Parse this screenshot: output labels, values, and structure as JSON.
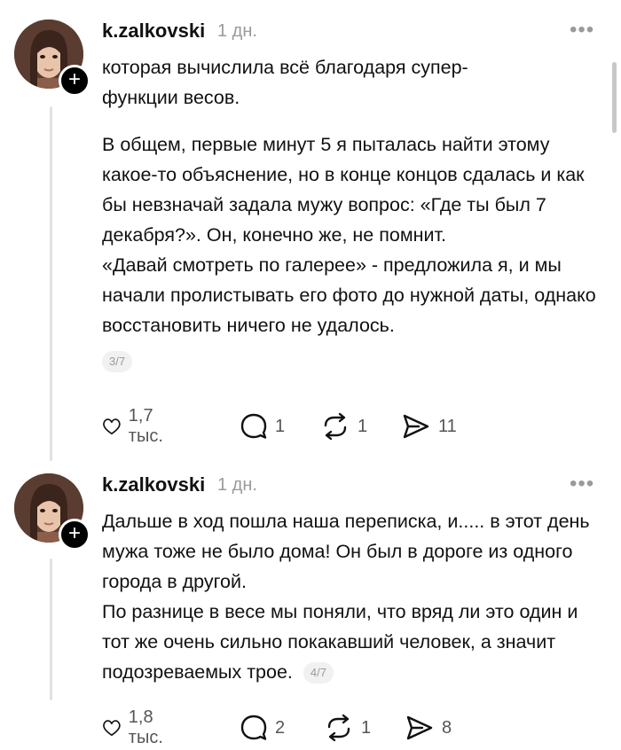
{
  "posts": [
    {
      "username": "k.zalkovski",
      "time": "1 дн.",
      "paragraphs": [
        "которая вычислила всё благодаря супер-функции весов.",
        "В общем, первые минут 5 я пыталась найти этому какое-то объяснение, но в конце концов сдалась и как бы невзначай задала мужу вопрос: «Где ты был 7 декабря?». Он, конечно же, не помнит.",
        "«Давай смотреть по галерее» - предложила я, и мы начали пролистывать его фото до нужной даты, однако восстановить ничего не удалось."
      ],
      "pager": "3/7",
      "likes": "1,7 тыс.",
      "comments": "1",
      "reposts": "1",
      "shares": "11"
    },
    {
      "username": "k.zalkovski",
      "time": "1 дн.",
      "paragraphs": [
        "Дальше в ход пошла наша переписка, и..... в этот день мужа тоже не было дома! Он был в дороге из одного города в другой.",
        "По разнице в весе мы поняли, что вряд ли это один и тот же очень сильно покакавший человек, а значит подозреваемых трое."
      ],
      "pager": "4/7",
      "likes": "1,8 тыс.",
      "comments": "2",
      "reposts": "1",
      "shares": "8"
    }
  ],
  "icons": {
    "more": "more-dots-icon",
    "like": "heart-icon",
    "comment": "comment-bubble-icon",
    "repost": "repost-icon",
    "share": "send-icon",
    "follow": "plus-icon"
  }
}
